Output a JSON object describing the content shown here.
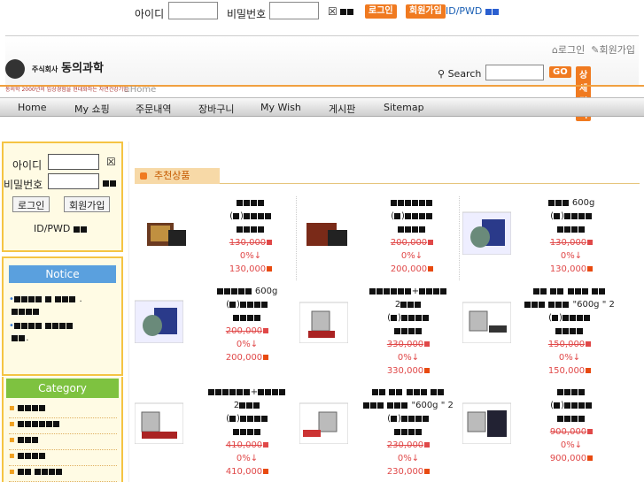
{
  "top": {
    "id_label": "아이디",
    "pw_label": "비밀번호",
    "login_btn": "로그인",
    "join_btn": "회원가입",
    "find": "ID/PWD"
  },
  "header": {
    "logo_small": "주식회사",
    "logo_big": "동의과학",
    "slogan": "동의학 2000년의 임상경험을 현대화하는 자연건강기업",
    "login_link": "로그인",
    "join_link": "회원가입",
    "search_label": "Search",
    "go": "GO",
    "advanced": "상세검색",
    "breadcrumb": "Home"
  },
  "nav": [
    "Home",
    "My 쇼핑",
    "주문내역",
    "장바구니",
    "My Wish",
    "게시판",
    "Sitemap"
  ],
  "side_login": {
    "id_label": "아이디",
    "pw_label": "비밀번호",
    "login_btn": "로그인",
    "join_btn": "회원가입",
    "find": "ID/PWD"
  },
  "notice": {
    "title": "Notice"
  },
  "category": {
    "title": "Category"
  },
  "section": {
    "title": "추천상품"
  },
  "products": [
    {
      "name_suffix": "",
      "orig": "130,000",
      "rate": "0%↓",
      "price": "130,000"
    },
    {
      "name_suffix": "",
      "orig": "200,000",
      "rate": "0%↓",
      "price": "200,000"
    },
    {
      "name_suffix": "600g",
      "orig": "130,000",
      "rate": "0%↓",
      "price": "130,000"
    },
    {
      "name_suffix": "600g",
      "orig": "200,000",
      "rate": "0%↓",
      "price": "200,000"
    },
    {
      "name_suffix": "2",
      "orig": "330,000",
      "rate": "0%↓",
      "price": "330,000"
    },
    {
      "name_suffix": "\"600g \" 2",
      "orig": "150,000",
      "rate": "0%↓",
      "price": "150,000"
    },
    {
      "name_suffix": "2",
      "orig": "410,000",
      "rate": "0%↓",
      "price": "410,000"
    },
    {
      "name_suffix": "\"600g \" 2",
      "orig": "230,000",
      "rate": "0%↓",
      "price": "230,000"
    },
    {
      "name_suffix": "",
      "orig": "900,000",
      "rate": "0%↓",
      "price": "900,000"
    }
  ],
  "colors": {
    "accent": "#f07a20",
    "notice_blue": "#5aa0de",
    "category_green": "#7ec240",
    "price_red": "#e04848"
  }
}
